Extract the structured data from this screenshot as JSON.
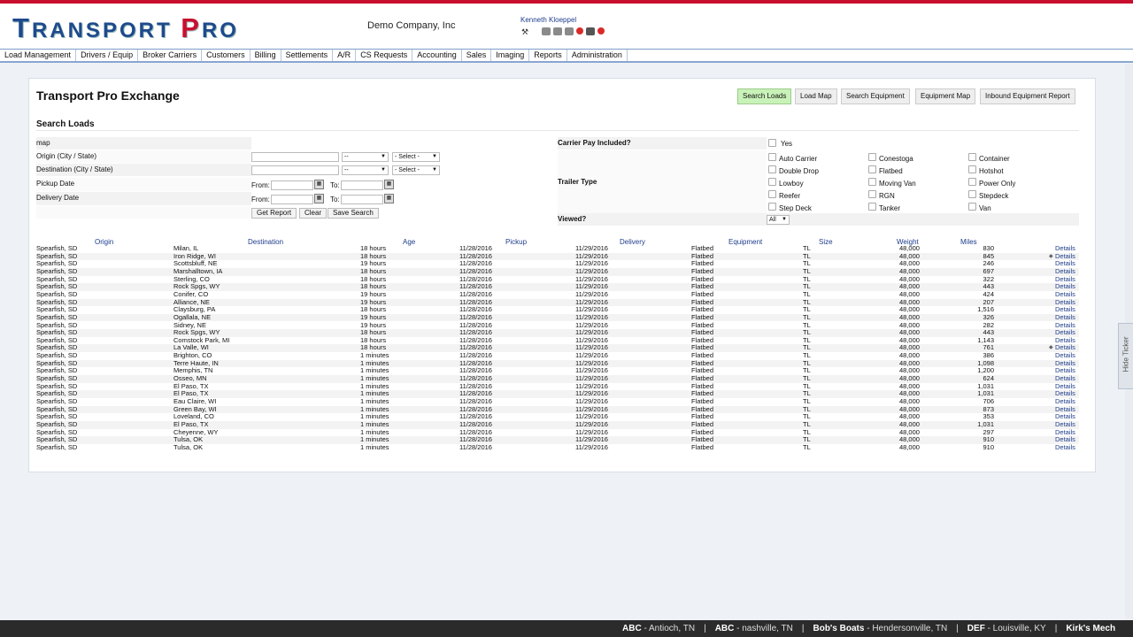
{
  "header": {
    "logo": {
      "t1": "T",
      "t2": "RANSPORT ",
      "p": "P",
      "t3": "RO"
    },
    "company": "Demo Company, Inc",
    "user": "Kenneth Kloeppel",
    "icons": [
      "wrench-icon",
      "search-icon",
      "users-icon",
      "mail-icon",
      "alert-icon",
      "print-icon",
      "logout-icon"
    ]
  },
  "menu": [
    "Load Management",
    "Drivers / Equip",
    "Broker Carriers",
    "Customers",
    "Billing",
    "Settlements",
    "A/R",
    "CS Requests",
    "Accounting",
    "Sales",
    "Imaging",
    "Reports",
    "Administration"
  ],
  "page": {
    "title": "Transport Pro Exchange",
    "buttons": [
      "Search Loads",
      "Load Map",
      "Search Equipment",
      "Equipment Map",
      "Inbound Equipment Report"
    ],
    "active_button": "Search Loads",
    "section": "Search Loads"
  },
  "form": {
    "map_label": "map",
    "origin_label": "Origin (City / State)",
    "destination_label": "Destination (City / State)",
    "pickup_label": "Pickup Date",
    "delivery_label": "Delivery Date",
    "dash": "--",
    "select": "- Select -",
    "from": "From:",
    "to": "To:",
    "get_report": "Get Report",
    "clear": "Clear",
    "save_search": "Save Search",
    "carrier_pay_label": "Carrier Pay Included?",
    "yes": "Yes",
    "trailer_type_label": "Trailer Type",
    "trailer_types": [
      [
        "Auto Carrier",
        "Conestoga",
        "Container"
      ],
      [
        "Double Drop",
        "Flatbed",
        "Hotshot"
      ],
      [
        "Lowboy",
        "Moving Van",
        "Power Only"
      ],
      [
        "Reefer",
        "RGN",
        "Stepdeck"
      ],
      [
        "Step Deck",
        "Tanker",
        "Van"
      ]
    ],
    "viewed_label": "Viewed?",
    "viewed_value": "All"
  },
  "table": {
    "headers": [
      "Origin",
      "Destination",
      "Age",
      "Pickup",
      "Delivery",
      "Equipment",
      "Size",
      "Weight",
      "Miles"
    ],
    "details_label": "Details",
    "rows": [
      [
        "Spearfish, SD",
        "Milan, IL",
        "18 hours",
        "11/28/2016",
        "11/29/2016",
        "Flatbed",
        "TL",
        "48,000",
        "830"
      ],
      [
        "Spearfish, SD",
        "Iron Ridge, WI",
        "18 hours",
        "11/28/2016",
        "11/29/2016",
        "Flatbed",
        "TL",
        "48,000",
        "845"
      ],
      [
        "Spearfish, SD",
        "Scottsbluff, NE",
        "19 hours",
        "11/28/2016",
        "11/29/2016",
        "Flatbed",
        "TL",
        "48,000",
        "246"
      ],
      [
        "Spearfish, SD",
        "Marshalltown, IA",
        "18 hours",
        "11/28/2016",
        "11/29/2016",
        "Flatbed",
        "TL",
        "48,000",
        "697"
      ],
      [
        "Spearfish, SD",
        "Sterling, CO",
        "18 hours",
        "11/28/2016",
        "11/29/2016",
        "Flatbed",
        "TL",
        "48,000",
        "322"
      ],
      [
        "Spearfish, SD",
        "Rock Spgs, WY",
        "18 hours",
        "11/28/2016",
        "11/29/2016",
        "Flatbed",
        "TL",
        "48,000",
        "443"
      ],
      [
        "Spearfish, SD",
        "Conifer, CO",
        "19 hours",
        "11/28/2016",
        "11/29/2016",
        "Flatbed",
        "TL",
        "48,000",
        "424"
      ],
      [
        "Spearfish, SD",
        "Alliance, NE",
        "19 hours",
        "11/28/2016",
        "11/29/2016",
        "Flatbed",
        "TL",
        "48,000",
        "207"
      ],
      [
        "Spearfish, SD",
        "Claysburg, PA",
        "18 hours",
        "11/28/2016",
        "11/29/2016",
        "Flatbed",
        "TL",
        "48,000",
        "1,516"
      ],
      [
        "Spearfish, SD",
        "Ogallala, NE",
        "19 hours",
        "11/28/2016",
        "11/29/2016",
        "Flatbed",
        "TL",
        "48,000",
        "326"
      ],
      [
        "Spearfish, SD",
        "Sidney, NE",
        "19 hours",
        "11/28/2016",
        "11/29/2016",
        "Flatbed",
        "TL",
        "48,000",
        "282"
      ],
      [
        "Spearfish, SD",
        "Rock Spgs, WY",
        "18 hours",
        "11/28/2016",
        "11/29/2016",
        "Flatbed",
        "TL",
        "48,000",
        "443"
      ],
      [
        "Spearfish, SD",
        "Comstock Park, MI",
        "18 hours",
        "11/28/2016",
        "11/29/2016",
        "Flatbed",
        "TL",
        "48,000",
        "1,143"
      ],
      [
        "Spearfish, SD",
        "La Valle, WI",
        "18 hours",
        "11/28/2016",
        "11/29/2016",
        "Flatbed",
        "TL",
        "48,000",
        "761"
      ],
      [
        "Spearfish, SD",
        "Brighton, CO",
        "1 minutes",
        "11/28/2016",
        "11/29/2016",
        "Flatbed",
        "TL",
        "48,000",
        "386"
      ],
      [
        "Spearfish, SD",
        "Terre Haute, IN",
        "1 minutes",
        "11/28/2016",
        "11/29/2016",
        "Flatbed",
        "TL",
        "48,000",
        "1,098"
      ],
      [
        "Spearfish, SD",
        "Memphis, TN",
        "1 minutes",
        "11/28/2016",
        "11/29/2016",
        "Flatbed",
        "TL",
        "48,000",
        "1,200"
      ],
      [
        "Spearfish, SD",
        "Osseo, MN",
        "1 minutes",
        "11/28/2016",
        "11/29/2016",
        "Flatbed",
        "TL",
        "48,000",
        "624"
      ],
      [
        "Spearfish, SD",
        "El Paso, TX",
        "1 minutes",
        "11/28/2016",
        "11/29/2016",
        "Flatbed",
        "TL",
        "48,000",
        "1,031"
      ],
      [
        "Spearfish, SD",
        "El Paso, TX",
        "1 minutes",
        "11/28/2016",
        "11/29/2016",
        "Flatbed",
        "TL",
        "48,000",
        "1,031"
      ],
      [
        "Spearfish, SD",
        "Eau Claire, WI",
        "1 minutes",
        "11/28/2016",
        "11/29/2016",
        "Flatbed",
        "TL",
        "48,000",
        "706"
      ],
      [
        "Spearfish, SD",
        "Green Bay, WI",
        "1 minutes",
        "11/28/2016",
        "11/29/2016",
        "Flatbed",
        "TL",
        "48,000",
        "873"
      ],
      [
        "Spearfish, SD",
        "Loveland, CO",
        "1 minutes",
        "11/28/2016",
        "11/29/2016",
        "Flatbed",
        "TL",
        "48,000",
        "353"
      ],
      [
        "Spearfish, SD",
        "El Paso, TX",
        "1 minutes",
        "11/28/2016",
        "11/29/2016",
        "Flatbed",
        "TL",
        "48,000",
        "1,031"
      ],
      [
        "Spearfish, SD",
        "Cheyenne, WY",
        "1 minutes",
        "11/28/2016",
        "11/29/2016",
        "Flatbed",
        "TL",
        "48,000",
        "297"
      ],
      [
        "Spearfish, SD",
        "Tulsa, OK",
        "1 minutes",
        "11/28/2016",
        "11/29/2016",
        "Flatbed",
        "TL",
        "48,000",
        "910"
      ],
      [
        "Spearfish, SD",
        "Tulsa, OK",
        "1 minutes",
        "11/28/2016",
        "11/29/2016",
        "Flatbed",
        "TL",
        "48,000",
        "910"
      ]
    ],
    "marked_rows": [
      1,
      13
    ]
  },
  "ticker": {
    "items": [
      {
        "name": "ABC",
        "loc": " - Antioch, TN"
      },
      {
        "name": "ABC",
        "loc": " - nashville, TN"
      },
      {
        "name": "Bob's Boats",
        "loc": " - Hendersonville, TN"
      },
      {
        "name": "DEF",
        "loc": " - Louisville, KY"
      },
      {
        "name": "Kirk's Mech",
        "loc": ""
      }
    ],
    "sep": "|",
    "hide_label": "Hide Ticker"
  },
  "colors": {
    "brand_blue": "#1e4a8c",
    "brand_red": "#c8102e",
    "active_button": "#c9f2b9",
    "link": "#1e3c8c"
  }
}
